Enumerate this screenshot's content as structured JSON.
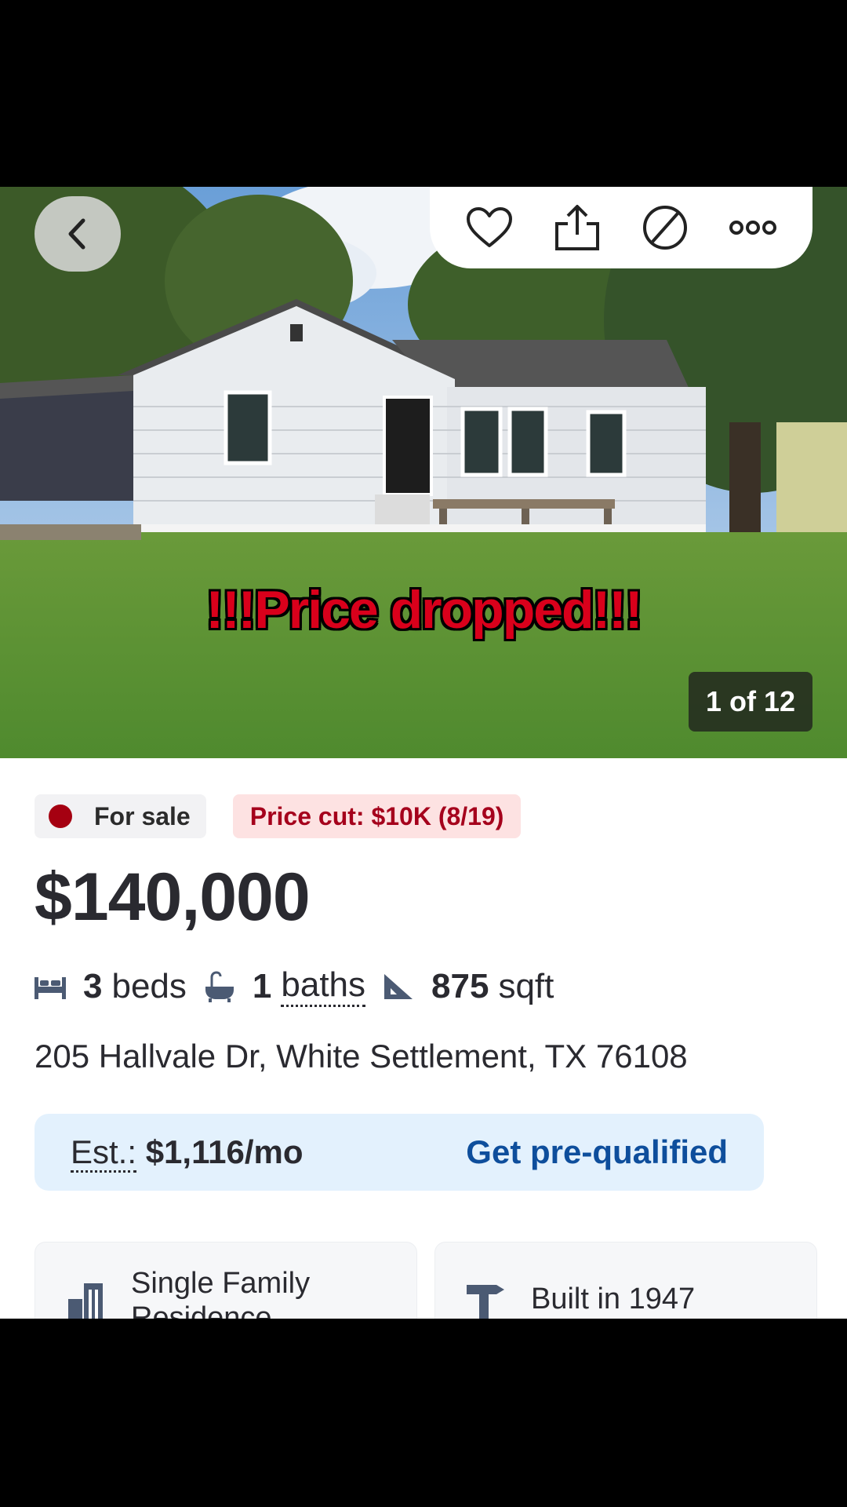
{
  "header": {
    "back_icon": "chevron-left-icon",
    "actions": [
      "heart-icon",
      "share-icon",
      "hide-icon",
      "more-icon"
    ]
  },
  "photo": {
    "overlay_text": "!!!Price dropped!!!",
    "counter": "1 of 12"
  },
  "listing": {
    "status": "For sale",
    "price_cut": "Price cut: $10K (8/19)",
    "price": "$140,000",
    "beds_value": "3",
    "beds_label": "beds",
    "baths_value": "1",
    "baths_label": "baths",
    "sqft_value": "875",
    "sqft_label": "sqft",
    "address": "205 Hallvale Dr, White Settlement, TX 76108"
  },
  "estimate": {
    "label": "Est.:",
    "value": "$1,116/mo",
    "cta": "Get pre-qualified"
  },
  "cards": [
    {
      "label": "Single Family Residence",
      "icon": "building-icon"
    },
    {
      "label": "Built in 1947",
      "icon": "hammer-icon"
    }
  ],
  "colors": {
    "accent_blue": "#0e4e9c",
    "sale_dot": "#a50011",
    "price_cut_text": "#a5001c"
  }
}
